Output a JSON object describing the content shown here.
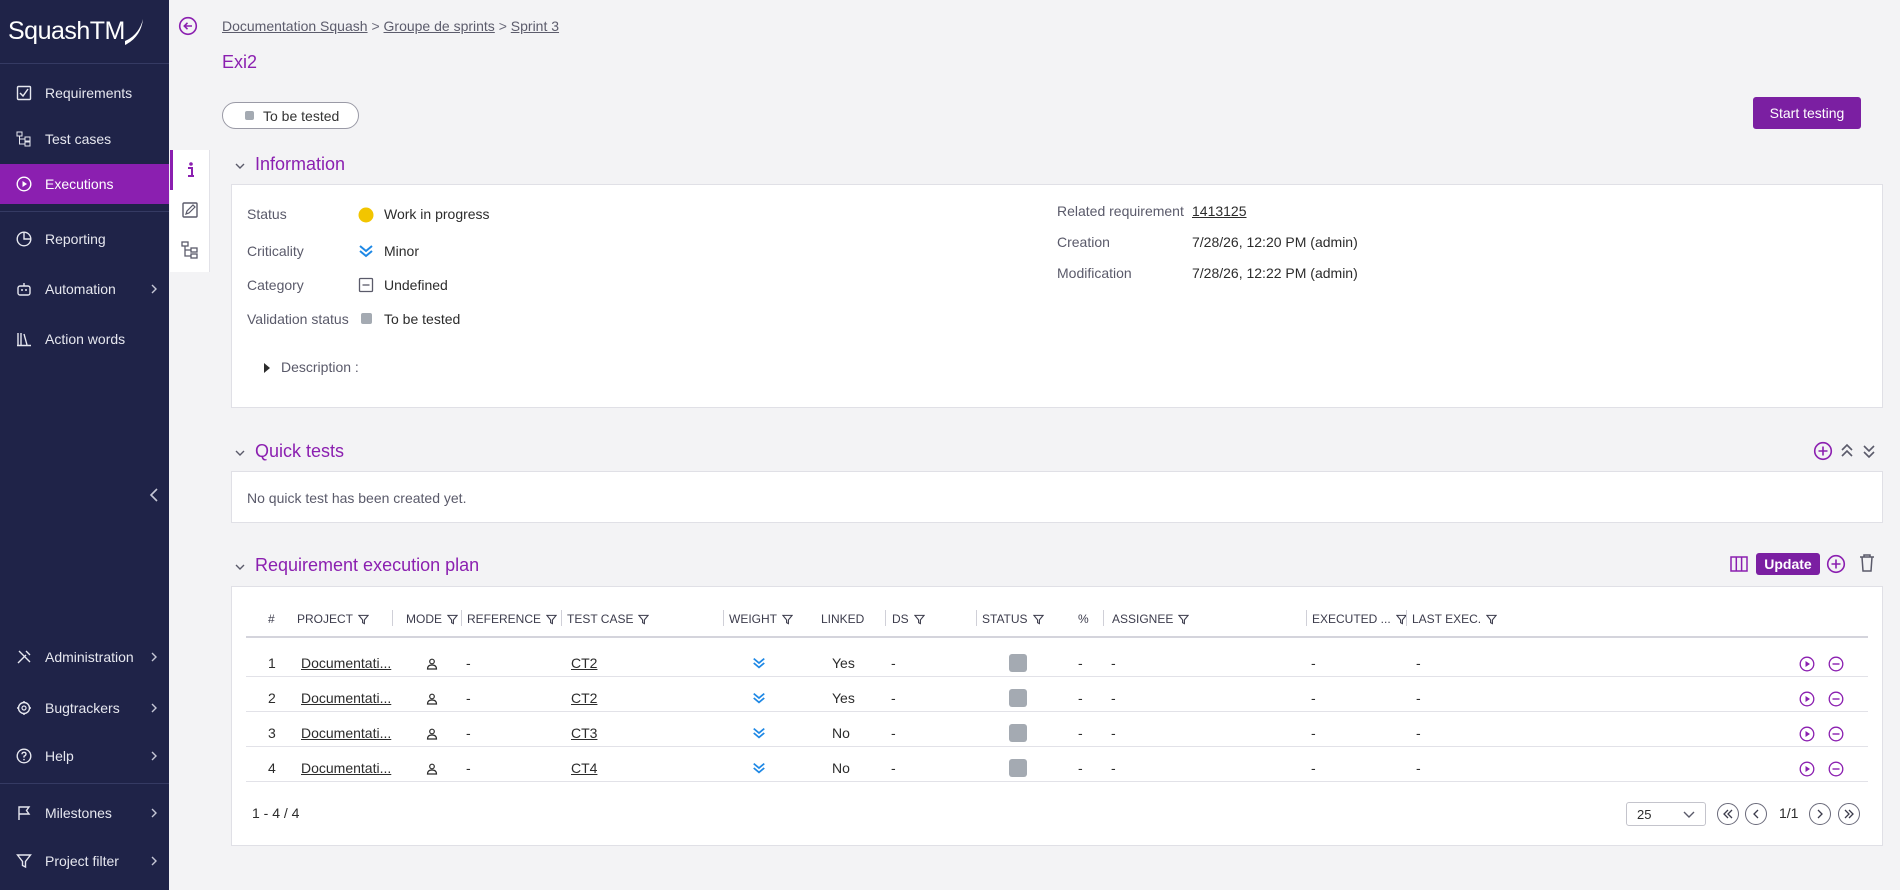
{
  "app": {
    "logo_text": "SquashTM"
  },
  "sidebar": {
    "items": [
      {
        "label": "Requirements",
        "icon": "checkbox-icon"
      },
      {
        "label": "Test cases",
        "icon": "tree-icon"
      },
      {
        "label": "Executions",
        "icon": "play-circle-icon"
      },
      {
        "label": "Reporting",
        "icon": "pie-chart-icon"
      },
      {
        "label": "Automation",
        "icon": "robot-icon"
      },
      {
        "label": "Action words",
        "icon": "library-icon"
      }
    ],
    "bottom_items": [
      {
        "label": "Administration",
        "icon": "tools-icon"
      },
      {
        "label": "Bugtrackers",
        "icon": "bug-icon"
      },
      {
        "label": "Help",
        "icon": "help-icon"
      },
      {
        "label": "Milestones",
        "icon": "flag-icon"
      },
      {
        "label": "Project filter",
        "icon": "filter-icon"
      }
    ]
  },
  "breadcrumb": {
    "items": [
      "Documentation Squash",
      "Groupe de sprints",
      "Sprint 3"
    ],
    "separator": ">"
  },
  "page": {
    "title": "Exi2",
    "status_pill": "To be tested",
    "start_button": "Start testing"
  },
  "information": {
    "title": "Information",
    "status_label": "Status",
    "status_value": "Work in progress",
    "criticality_label": "Criticality",
    "criticality_value": "Minor",
    "category_label": "Category",
    "category_value": "Undefined",
    "validation_label": "Validation status",
    "validation_value": "To be tested",
    "description_label": "Description :",
    "related_label": "Related requirement",
    "related_value": "1413125",
    "creation_label": "Creation",
    "creation_value": "7/28/26, 12:20 PM (admin)",
    "modification_label": "Modification",
    "modification_value": "7/28/26, 12:22 PM (admin)"
  },
  "quick_tests": {
    "title": "Quick tests",
    "empty_text": "No quick test has been created yet."
  },
  "plan": {
    "title": "Requirement execution plan",
    "update_button": "Update",
    "columns": [
      "#",
      "PROJECT",
      "MODE",
      "REFERENCE",
      "TEST CASE",
      "WEIGHT",
      "LINKED",
      "DS",
      "STATUS",
      "%",
      "ASSIGNEE",
      "EXECUTED ...",
      "LAST EXEC."
    ],
    "rows": [
      {
        "num": "1",
        "project": "Documentati...",
        "reference": "-",
        "test_case": "CT2",
        "linked": "Yes",
        "ds": "-",
        "pct": "-",
        "assignee": "-",
        "executed": "-",
        "last_exec": "-"
      },
      {
        "num": "2",
        "project": "Documentati...",
        "reference": "-",
        "test_case": "CT2",
        "linked": "Yes",
        "ds": "-",
        "pct": "-",
        "assignee": "-",
        "executed": "-",
        "last_exec": "-"
      },
      {
        "num": "3",
        "project": "Documentati...",
        "reference": "-",
        "test_case": "CT3",
        "linked": "No",
        "ds": "-",
        "pct": "-",
        "assignee": "-",
        "executed": "-",
        "last_exec": "-"
      },
      {
        "num": "4",
        "project": "Documentati...",
        "reference": "-",
        "test_case": "CT4",
        "linked": "No",
        "ds": "-",
        "pct": "-",
        "assignee": "-",
        "executed": "-",
        "last_exec": "-"
      }
    ],
    "count_text": "1 - 4 / 4",
    "page_size": "25",
    "page_indicator": "1/1"
  },
  "colors": {
    "accent": "#8b1fb0",
    "sidebar_bg": "#1f2348",
    "status_yellow": "#f2c500",
    "weight_blue": "#1e88e5"
  }
}
